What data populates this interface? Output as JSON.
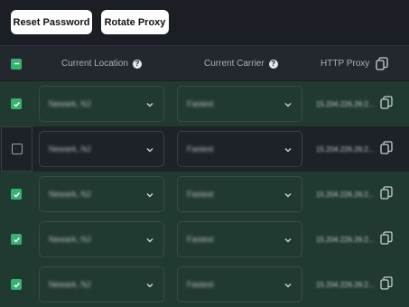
{
  "toolbar": {
    "reset_label": "Reset Password",
    "rotate_label": "Rotate Proxy"
  },
  "table": {
    "headers": {
      "location": "Current Location",
      "carrier": "Current Carrier",
      "proxy": "HTTP Proxy",
      "help_glyph": "?"
    },
    "rows": [
      {
        "selected": true,
        "location": "Newark, NJ",
        "carrier": "Fastest",
        "proxy": "15.204.226.26:2..."
      },
      {
        "selected": false,
        "location": "Newark, NJ",
        "carrier": "Fastest",
        "proxy": "15.204.226.26:2..."
      },
      {
        "selected": true,
        "location": "Newark, NJ",
        "carrier": "Fastest",
        "proxy": "15.204.226.26:2..."
      },
      {
        "selected": true,
        "location": "Newark, NJ",
        "carrier": "Fastest",
        "proxy": "15.204.226.26:2..."
      },
      {
        "selected": true,
        "location": "Newark, NJ",
        "carrier": "Fastest",
        "proxy": "15.204.226.26:2..."
      }
    ]
  },
  "colors": {
    "accent": "#37b26f",
    "selected_row": "#213a31",
    "background": "#1b1f25"
  },
  "icons": {
    "checkbox_checked": "check-icon",
    "dropdown": "chevron-down-icon",
    "copy": "copy-icon",
    "help": "question-icon"
  }
}
